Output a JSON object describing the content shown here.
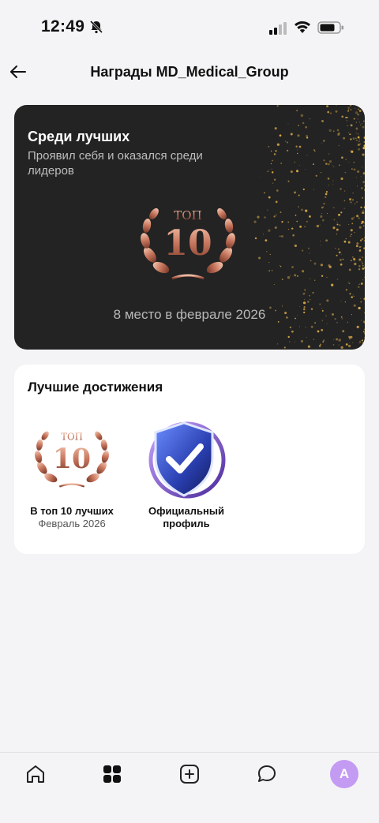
{
  "status_bar": {
    "time": "12:49"
  },
  "header": {
    "title": "Награды MD_Medical_Group"
  },
  "hero": {
    "title": "Среди лучших",
    "description": "Проявил себя и оказался среди лидеров",
    "badge_top": "ТОП",
    "badge_number": "10",
    "rank_text": "8 место в феврале 2026"
  },
  "achievements": {
    "title": "Лучшие достижения",
    "items": [
      {
        "badge_top": "ТОП",
        "badge_number": "10",
        "label": "В топ 10 лучших",
        "date": "Февраль 2026"
      },
      {
        "label": "Официальный профиль"
      }
    ]
  },
  "nav": {
    "avatar_letter": "A"
  },
  "colors": {
    "accent": "#c39bf3",
    "hero_bg": "#232323",
    "gold": "#d8a94a",
    "bronze": "#c9826c"
  }
}
